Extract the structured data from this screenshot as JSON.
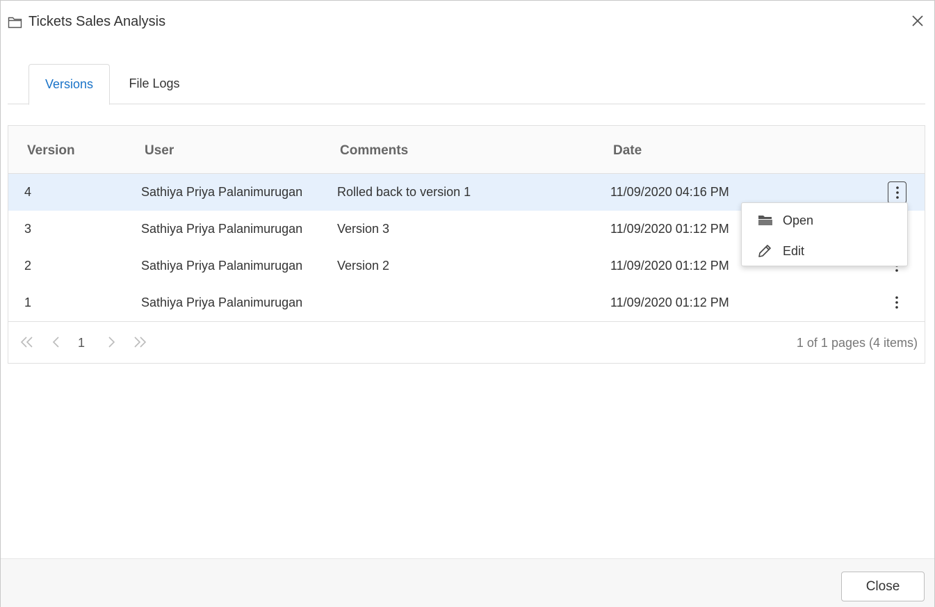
{
  "dialog": {
    "title": "Tickets Sales Analysis",
    "title_icon": "folder-icon",
    "close_icon": "close-icon"
  },
  "tabs": [
    {
      "label": "Versions",
      "active": true
    },
    {
      "label": "File Logs",
      "active": false
    }
  ],
  "grid": {
    "columns": [
      "Version",
      "User",
      "Comments",
      "Date"
    ],
    "rows": [
      {
        "version": "4",
        "user": "Sathiya Priya Palanimurugan",
        "comments": "Rolled back to version 1",
        "date": "11/09/2020 04:16 PM",
        "selected": true
      },
      {
        "version": "3",
        "user": "Sathiya Priya Palanimurugan",
        "comments": "Version 3",
        "date": "11/09/2020 01:12 PM",
        "selected": false
      },
      {
        "version": "2",
        "user": "Sathiya Priya Palanimurugan",
        "comments": "Version 2",
        "date": "11/09/2020 01:12 PM",
        "selected": false
      },
      {
        "version": "1",
        "user": "Sathiya Priya Palanimurugan",
        "comments": "",
        "date": "11/09/2020 01:12 PM",
        "selected": false
      }
    ],
    "row_action_icon": "more-vertical-icon"
  },
  "pager": {
    "current_page": "1",
    "info": "1 of 1 pages (4 items)",
    "icons": [
      "first-page-icon",
      "previous-page-icon",
      "next-page-icon",
      "last-page-icon"
    ]
  },
  "context_menu": {
    "items": [
      {
        "label": "Open",
        "icon": "folder-open-icon"
      },
      {
        "label": "Edit",
        "icon": "pencil-icon"
      }
    ]
  },
  "footer": {
    "close_label": "Close"
  },
  "colors": {
    "accent": "#1a73c8",
    "selected_row": "#e6f0fc",
    "header_bg": "#fafafa",
    "footer_bg": "#f7f7f7"
  }
}
